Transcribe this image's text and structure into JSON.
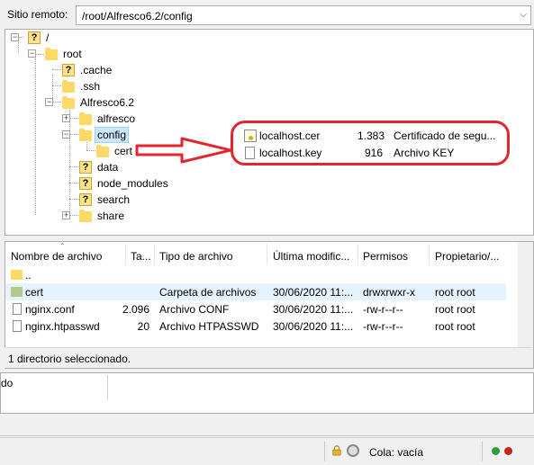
{
  "remote_bar": {
    "label": "Sitio remoto:",
    "path": "/root/Alfresco6.2/config"
  },
  "tree": {
    "root": "/",
    "root_dir": "root",
    "cache": ".cache",
    "ssh": ".ssh",
    "alfresco_dir": "Alfresco6.2",
    "alfresco": "alfresco",
    "config": "config",
    "cert": "cert",
    "data": "data",
    "node_modules": "node_modules",
    "search": "search",
    "share": "share"
  },
  "callout": {
    "rows": [
      {
        "name": "localhost.cer",
        "size": "1.383",
        "type": "Certificado de segu..."
      },
      {
        "name": "localhost.key",
        "size": "916",
        "type": "Archivo KEY"
      }
    ],
    "accent": "#e3262e"
  },
  "file_list": {
    "columns": [
      "Nombre de archivo",
      "Ta...",
      "Tipo de archivo",
      "Última modific...",
      "Permisos",
      "Propietario/..."
    ],
    "rows": [
      {
        "name": "..",
        "size": "",
        "type": "",
        "modified": "",
        "perms": "",
        "owner": ""
      },
      {
        "name": "cert",
        "size": "",
        "type": "Carpeta de archivos",
        "modified": "30/06/2020 11:...",
        "perms": "drwxrwxr-x",
        "owner": "root root"
      },
      {
        "name": "nginx.conf",
        "size": "2.096",
        "type": "Archivo CONF",
        "modified": "30/06/2020 11:...",
        "perms": "-rw-r--r--",
        "owner": "root root"
      },
      {
        "name": "nginx.htpasswd",
        "size": "20",
        "type": "Archivo HTPASSWD",
        "modified": "30/06/2020 11:...",
        "perms": "-rw-r--r--",
        "owner": "root root"
      }
    ],
    "status": "1 directorio seleccionado."
  },
  "queue": {
    "cell_text": "do"
  },
  "statusbar": {
    "queue_label": "Cola: vacía"
  },
  "icons": {
    "folder": "folder-icon",
    "unknown_folder": "question-folder-icon",
    "file": "file-icon",
    "certificate": "certificate-icon",
    "lock": "lock-icon",
    "speed": "speed-limit-icon",
    "led_green": "#2e9e3a",
    "led_red": "#c0281e"
  }
}
